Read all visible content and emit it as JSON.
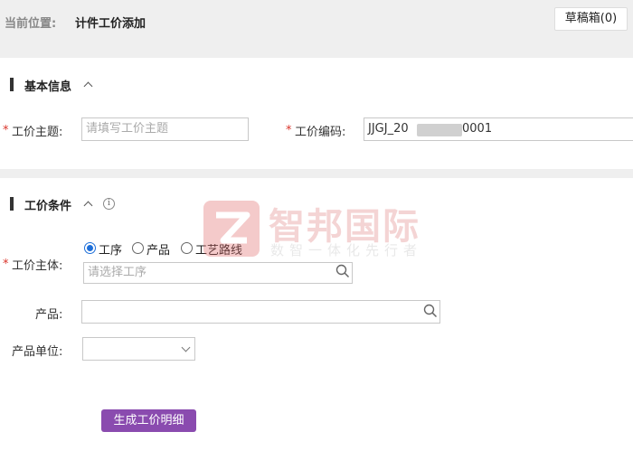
{
  "header": {
    "breadcrumb_label": "当前位置:",
    "breadcrumb_current": "计件工价添加",
    "draft_button": "草稿箱(0)"
  },
  "basic_info": {
    "title": "基本信息",
    "subject_label": "工价主题:",
    "subject_placeholder": "请填写工价主题",
    "code_label": "工价编码:",
    "code_prefix": "JJGJ_20",
    "code_suffix": "0001"
  },
  "conditions": {
    "title": "工价条件",
    "subject_label": "工价主体:",
    "options": [
      "工序",
      "产品",
      "工艺路线"
    ],
    "selected": "工序",
    "process_placeholder": "请选择工序",
    "product_label": "产品:",
    "product_value": "",
    "unit_label": "产品单位:",
    "unit_value": ""
  },
  "actions": {
    "generate_button": "生成工价明细"
  },
  "watermark": {
    "brand": "智邦国际",
    "slogan": "数智一体化先行者"
  },
  "colors": {
    "accent": "#8a4baf",
    "required": "#d9342b",
    "radio_selected": "#1e6fd9"
  }
}
